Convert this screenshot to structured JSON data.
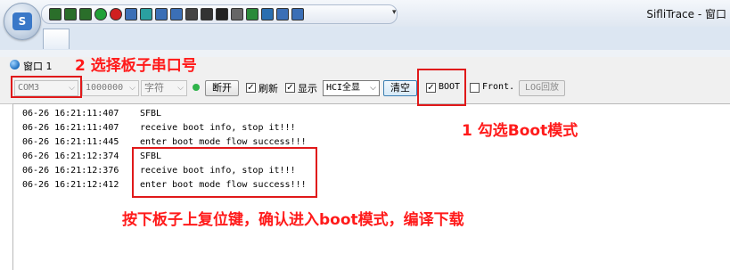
{
  "window": {
    "app_title": "SifliTrace - 窗口",
    "orb_label": "S",
    "window_label": "窗口 1"
  },
  "quick_access": {
    "icons": [
      "save-icon",
      "layout-h-icon",
      "layout-v-icon",
      "green-circle-icon",
      "red-circle-icon",
      "edit-icon",
      "refresh-icon",
      "u-icon",
      "u2-icon",
      "clock-icon",
      "grid-icon",
      "terminal-icon",
      "search-icon",
      "plugin-icon",
      "image-icon",
      "screen-icon",
      "navigate-icon"
    ],
    "more": "▾"
  },
  "toolbar": {
    "port": "COM3",
    "baud": "1000000",
    "charset": "字符",
    "disconnect_label": "断开",
    "refresh_label": "刷新",
    "refresh_checked": true,
    "display_label": "显示",
    "display_checked": true,
    "filter": "HCI全显",
    "clear_label": "清空",
    "boot_label": "BOOT",
    "boot_checked": true,
    "front_label": "Front.",
    "front_checked": false,
    "log_replay_label": "LOG回放",
    "check_mark": "✓",
    "dropdown_arrow": "⌵"
  },
  "annotations": {
    "step2": "2 选择板子串口号",
    "step1": "1 勾选Boot模式",
    "reset": "按下板子上复位键，确认进入boot模式，编译下载"
  },
  "log": [
    {
      "time": "06-26 16:21:11:407",
      "msg": "SFBL"
    },
    {
      "time": "06-26 16:21:11:407",
      "msg": "receive boot info, stop it!!!"
    },
    {
      "time": "06-26 16:21:11:445",
      "msg": "enter boot mode flow success!!!"
    },
    {
      "time": "06-26 16:21:12:374",
      "msg": "SFBL"
    },
    {
      "time": "06-26 16:21:12:376",
      "msg": "receive boot info, stop it!!!"
    },
    {
      "time": "06-26 16:21:12:412",
      "msg": "enter boot mode flow success!!!"
    }
  ],
  "colors": {
    "annotation_red": "#ff1a1a",
    "box_red": "#e0191a",
    "status_green": "#2fb34a"
  }
}
